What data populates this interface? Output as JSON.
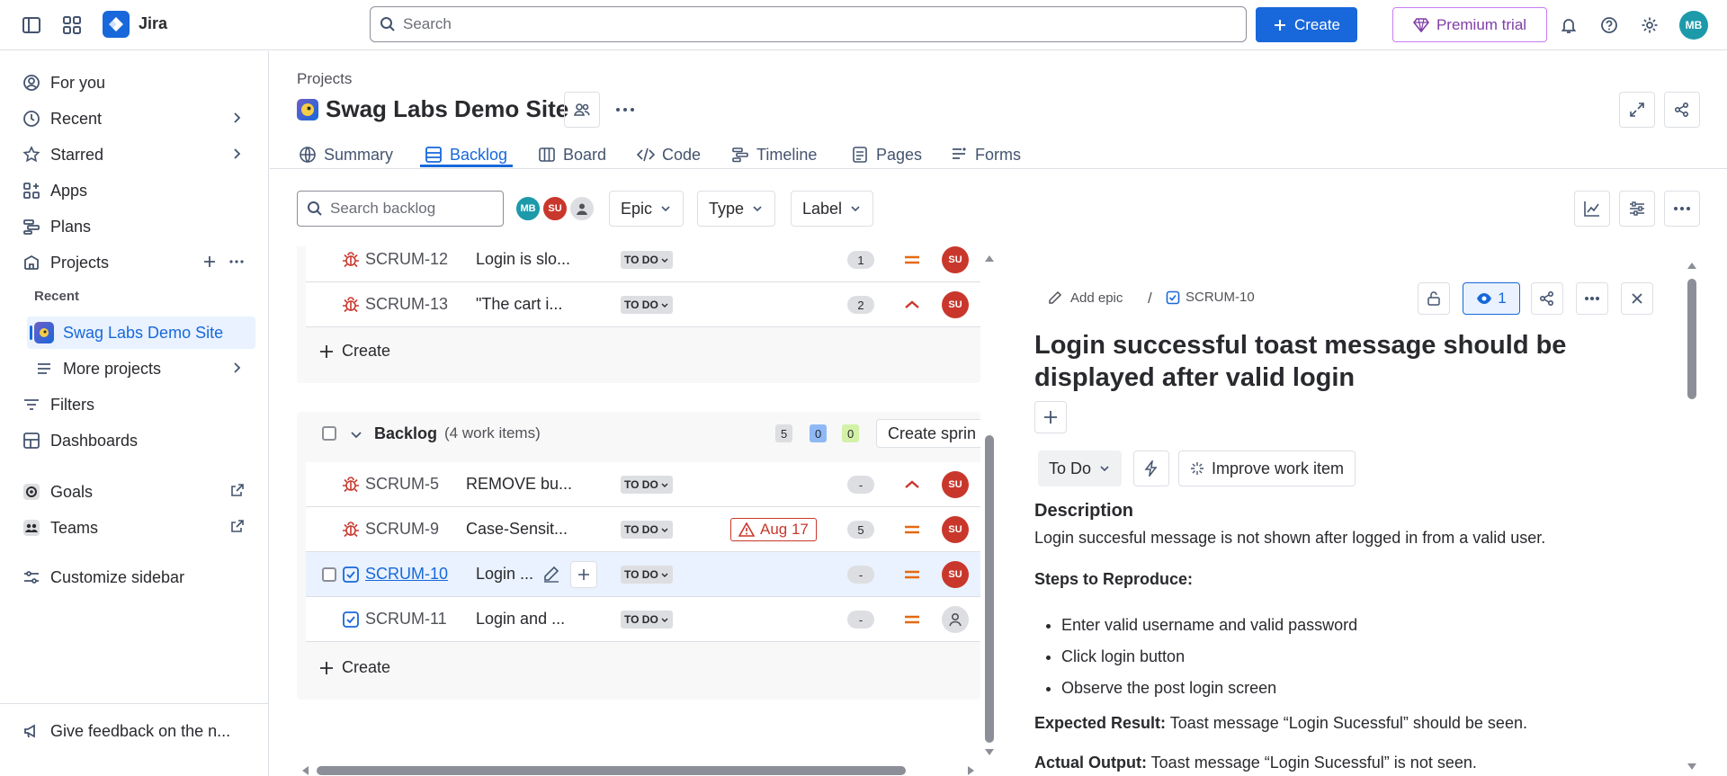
{
  "topbar": {
    "app_name": "Jira",
    "search_placeholder": "Search",
    "create_label": "Create",
    "premium_label": "Premium trial",
    "user_initials": "MB"
  },
  "sidebar": {
    "items": [
      {
        "label": "For you"
      },
      {
        "label": "Recent"
      },
      {
        "label": "Starred"
      },
      {
        "label": "Apps"
      },
      {
        "label": "Plans"
      },
      {
        "label": "Projects"
      }
    ],
    "recent_label": "Recent",
    "active_project": "Swag Labs Demo Site",
    "more_projects": "More projects",
    "filters": "Filters",
    "dashboards": "Dashboards",
    "goals": "Goals",
    "teams": "Teams",
    "customize": "Customize sidebar",
    "feedback": "Give feedback on the n..."
  },
  "header": {
    "breadcrumb": "Projects",
    "project_title": "Swag Labs Demo Site",
    "tabs": [
      {
        "label": "Summary"
      },
      {
        "label": "Backlog"
      },
      {
        "label": "Board"
      },
      {
        "label": "Code"
      },
      {
        "label": "Timeline"
      },
      {
        "label": "Pages"
      },
      {
        "label": "Forms"
      }
    ]
  },
  "toolbar": {
    "search_placeholder": "Search backlog",
    "avatars": [
      "MB",
      "SU"
    ],
    "filters": [
      "Epic",
      "Type",
      "Label"
    ]
  },
  "sprint": {
    "rows": [
      {
        "key": "SCRUM-12",
        "summary": "Login is slo...",
        "status": "TO DO",
        "estimate": "1",
        "priority": "medium",
        "assignee": "SU"
      },
      {
        "key": "SCRUM-13",
        "summary": "\"The cart i...",
        "status": "TO DO",
        "estimate": "2",
        "priority": "high",
        "assignee": "SU"
      }
    ],
    "create_label": "Create"
  },
  "backlog": {
    "title": "Backlog",
    "count": "(4 work items)",
    "pills": [
      "5",
      "0",
      "0"
    ],
    "create_sprint": "Create sprin",
    "rows": [
      {
        "key": "SCRUM-5",
        "summary": "REMOVE bu...",
        "status": "TO DO",
        "estimate": "-",
        "priority": "high",
        "assignee": "SU"
      },
      {
        "key": "SCRUM-9",
        "summary": "Case-Sensit...",
        "status": "TO DO",
        "due": "Aug 17",
        "estimate": "5",
        "priority": "medium",
        "assignee": "SU"
      },
      {
        "key": "SCRUM-10",
        "summary": "Login ...",
        "status": "TO DO",
        "estimate": "-",
        "priority": "medium",
        "assignee": "SU"
      },
      {
        "key": "SCRUM-11",
        "summary": "Login and ...",
        "status": "TO DO",
        "estimate": "-",
        "priority": "medium",
        "assignee": ""
      }
    ],
    "create_label": "Create"
  },
  "detail": {
    "add_epic": "Add epic",
    "separator": "/",
    "key": "SCRUM-10",
    "watchers": "1",
    "title": "Login successful toast message should be displayed after valid login",
    "status": "To Do",
    "improve": "Improve work item",
    "description_heading": "Description",
    "description": "Login succesful message is not shown after logged in from a valid user.",
    "steps_heading": "Steps to Reproduce:",
    "steps": [
      "Enter valid username and valid password",
      "Click login button",
      "Observe the post login screen"
    ],
    "expected_label": "Expected Result:",
    "expected_text": "Toast message “Login Sucessful” should be seen.",
    "actual_label": "Actual Output:",
    "actual_text": "Toast message “Login Sucessful” is not seen."
  },
  "colors": {
    "brand": "#1868db",
    "danger": "#c9372c",
    "warning": "#e56910",
    "purple": "#803fa5",
    "teal": "#1d9aaa"
  }
}
